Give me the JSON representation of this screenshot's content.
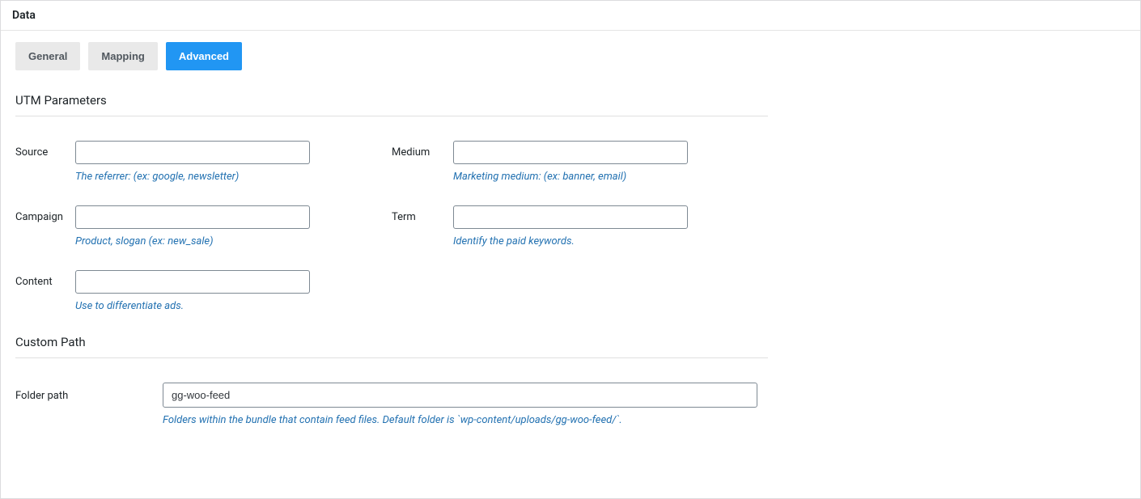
{
  "panel": {
    "title": "Data"
  },
  "tabs": {
    "general": "General",
    "mapping": "Mapping",
    "advanced": "Advanced"
  },
  "utm": {
    "section_title": "UTM Parameters",
    "source": {
      "label": "Source",
      "value": "",
      "hint": "The referrer: (ex: google, newsletter)"
    },
    "medium": {
      "label": "Medium",
      "value": "",
      "hint": "Marketing medium: (ex: banner, email)"
    },
    "campaign": {
      "label": "Campaign",
      "value": "",
      "hint": "Product, slogan (ex: new_sale)"
    },
    "term": {
      "label": "Term",
      "value": "",
      "hint": "Identify the paid keywords."
    },
    "content": {
      "label": "Content",
      "value": "",
      "hint": "Use to differentiate ads."
    }
  },
  "custom_path": {
    "section_title": "Custom Path",
    "folder": {
      "label": "Folder path",
      "value": "gg-woo-feed",
      "hint": "Folders within the bundle that contain feed files. Default folder is `wp-content/uploads/gg-woo-feed/`."
    }
  }
}
